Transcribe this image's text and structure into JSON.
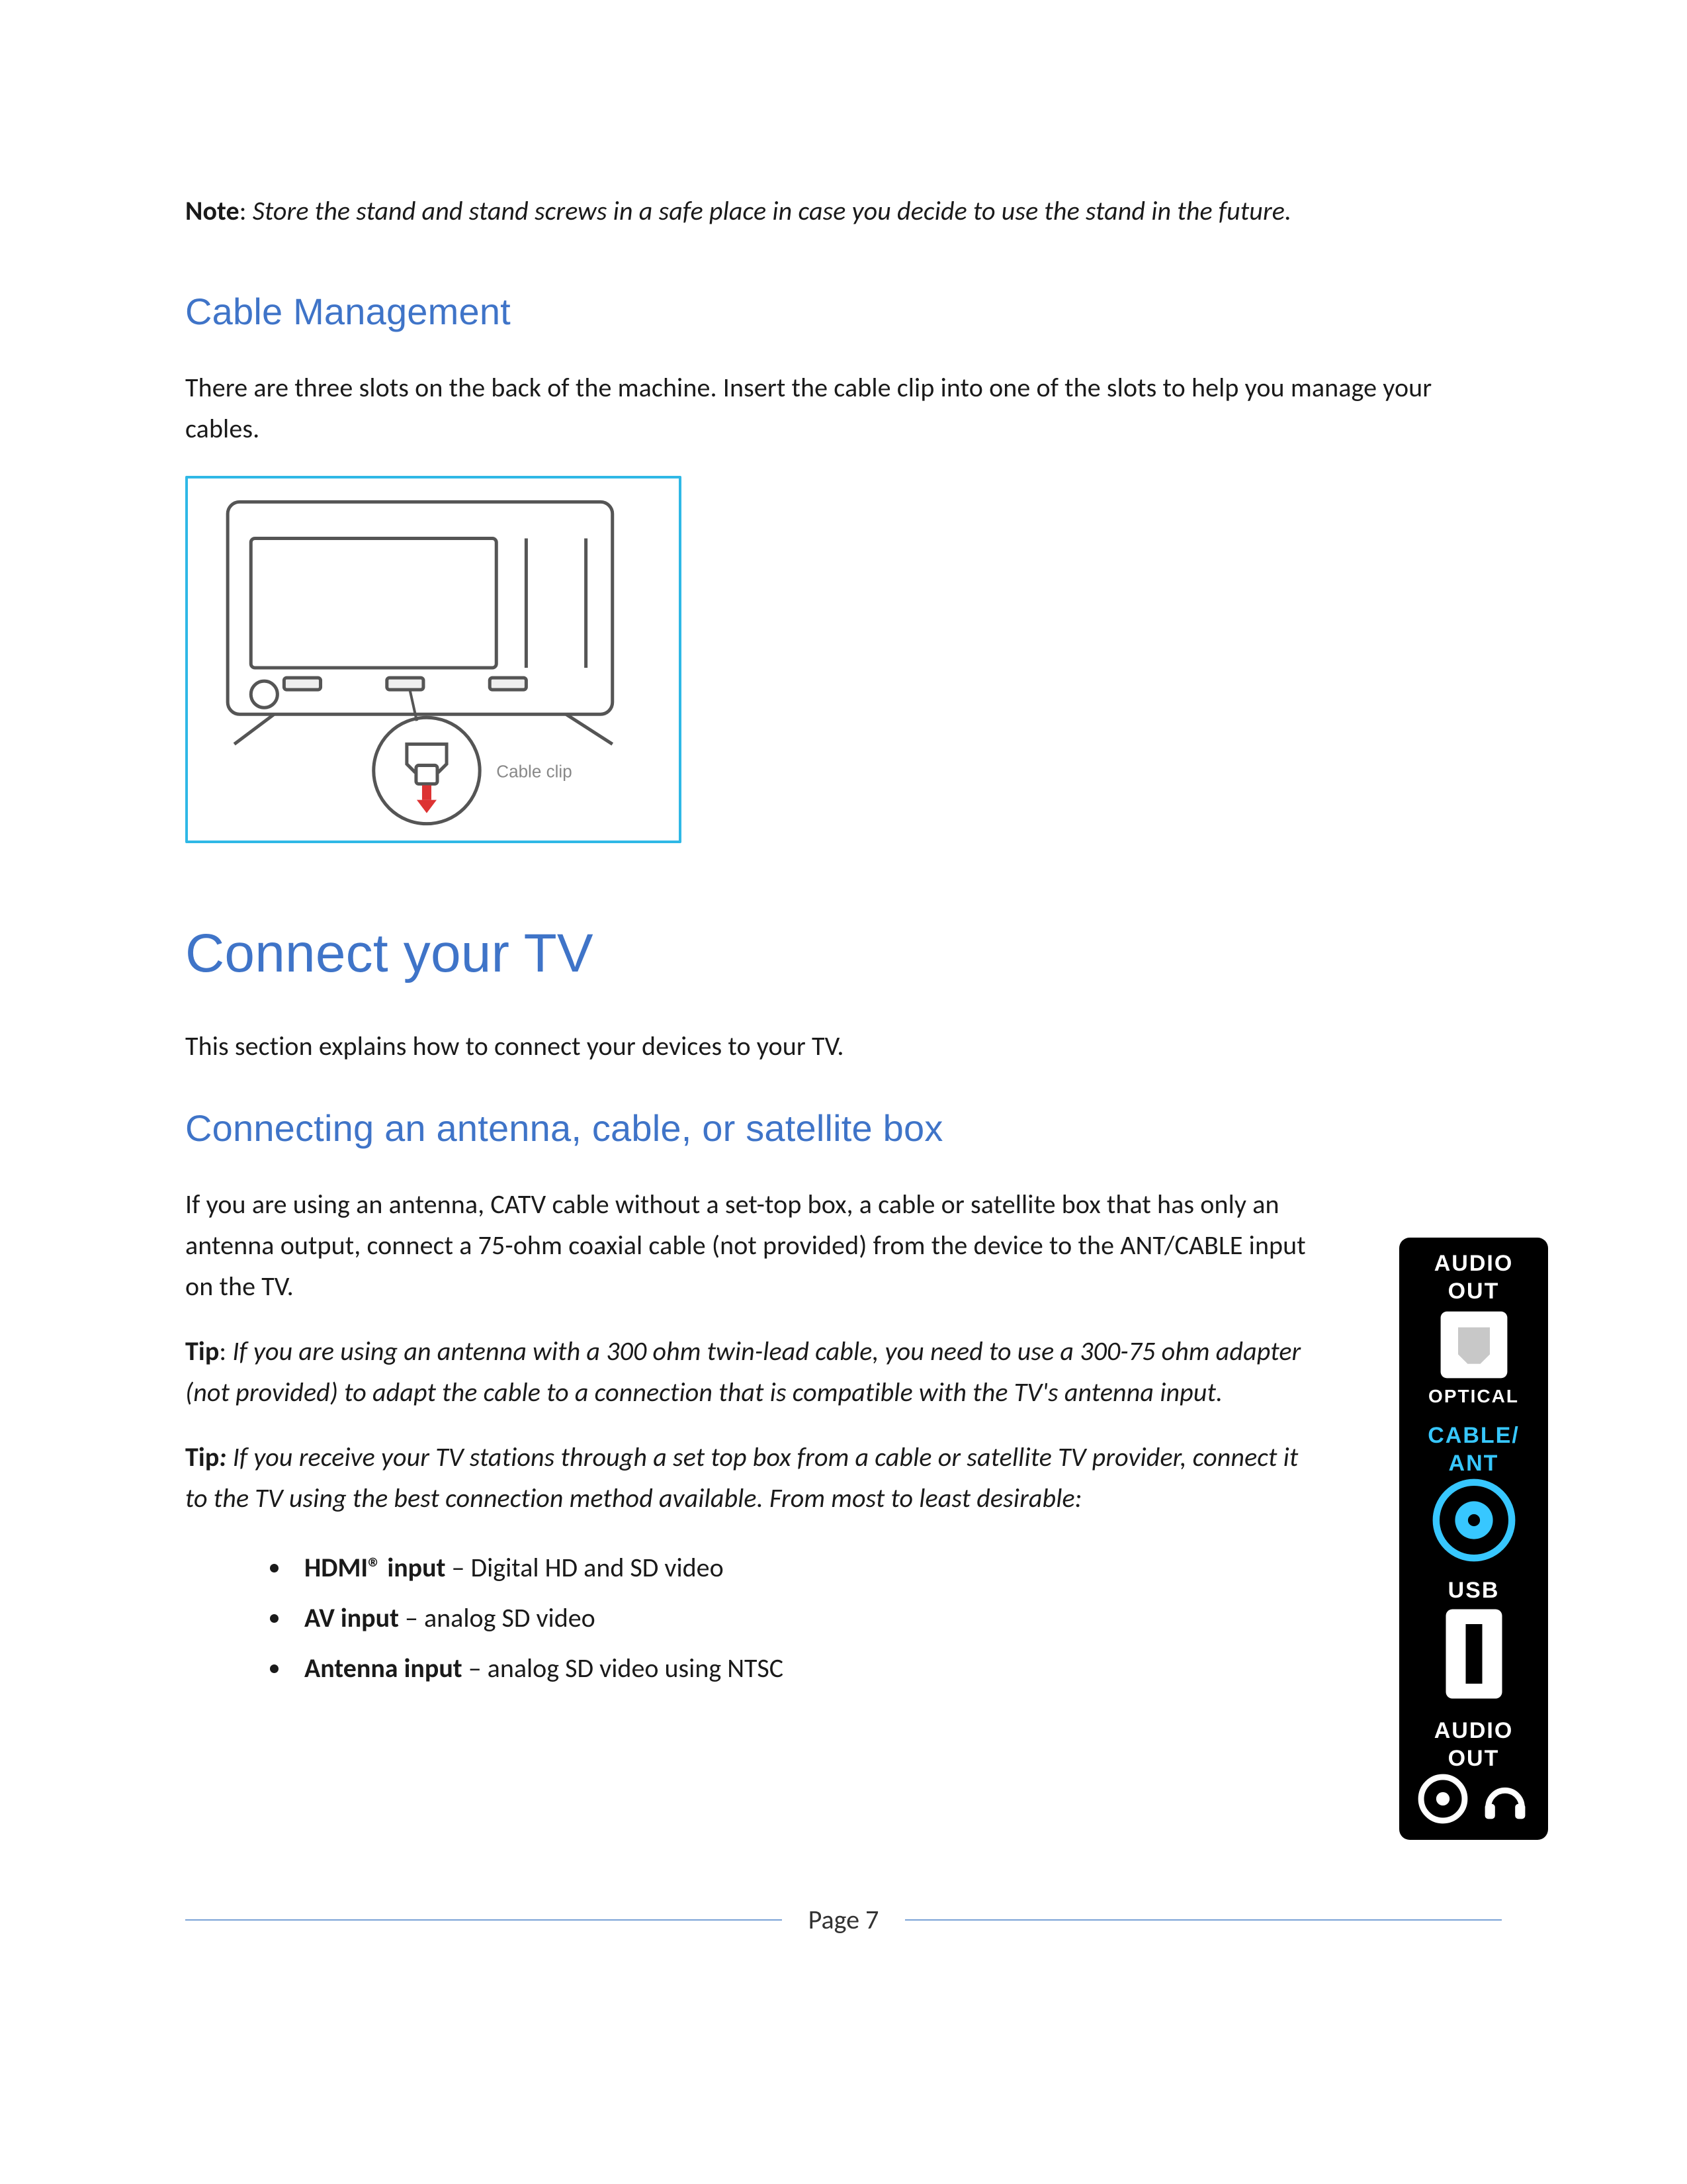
{
  "note": {
    "label": "Note",
    "text": "Store the stand and stand screws in a safe place in case you decide to use the stand in the future."
  },
  "cable_mgmt": {
    "heading": "Cable Management",
    "body": "There are three slots on the back of the machine. Insert the cable clip into one of the slots to help you manage your cables.",
    "diagram_caption": "Cable clip"
  },
  "connect_tv": {
    "heading": "Connect your TV",
    "intro": "This section explains how to connect your devices to your TV."
  },
  "antenna": {
    "heading": "Connecting an antenna, cable, or satellite box",
    "body": "If you are using an antenna, CATV cable without a set-top box, a cable or satellite box that has only an antenna output, connect a 75-ohm coaxial cable (not provided) from the device to the ANT/CABLE input on the TV.",
    "tip1_label": "Tip",
    "tip1_text": "If you are using an antenna with a 300 ohm twin-lead cable, you need to use a 300-75 ohm adapter (not provided) to adapt the cable to a connection that is compatible with the TV's antenna input.",
    "tip2_label": "Tip",
    "tip2_text": "If you receive your TV stations through a set top box from a cable or satellite TV provider, connect it to the TV using the best connection method available. From most to least desirable:",
    "bullets": [
      {
        "strong": "HDMI® input",
        "rest": " – Digital HD and SD video"
      },
      {
        "strong": "AV input",
        "rest": " – analog SD video"
      },
      {
        "strong": "Antenna input",
        "rest": " – analog SD video using NTSC"
      }
    ]
  },
  "ports": {
    "audio_out_top": "AUDIO",
    "audio_out_top2": "OUT",
    "optical": "OPTICAL",
    "cable": "CABLE/",
    "ant": "ANT",
    "usb": "USB",
    "audio_out_bot": "AUDIO",
    "audio_out_bot2": "OUT"
  },
  "footer": {
    "page_label": "Page 7"
  }
}
